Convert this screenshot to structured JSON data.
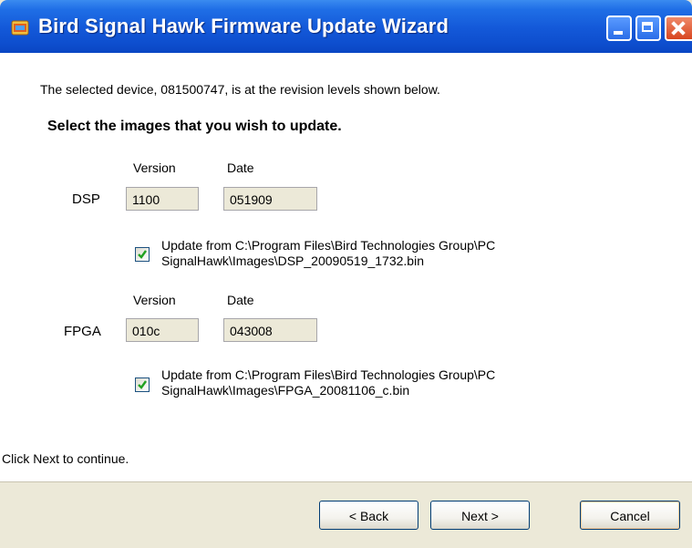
{
  "window": {
    "title": "Bird Signal Hawk Firmware Update Wizard",
    "accent": "#1358d8"
  },
  "intro_text": "The selected device, 081500747, is at the revision levels shown below.",
  "heading": "Select the images that you wish to update.",
  "dsp": {
    "label": "DSP",
    "version_header": "Version",
    "date_header": "Date",
    "version": "1100",
    "date": "051909",
    "update_checked": true,
    "update_line1": "Update from C:\\Program Files\\Bird Technologies Group\\PC",
    "update_line2": "SignalHawk\\Images\\DSP_20090519_1732.bin"
  },
  "fpga": {
    "label": "FPGA",
    "version_header": "Version",
    "date_header": "Date",
    "version": "010c",
    "date": "043008",
    "update_checked": true,
    "update_line1": "Update from C:\\Program Files\\Bird Technologies Group\\PC",
    "update_line2": "SignalHawk\\Images\\FPGA_20081106_c.bin"
  },
  "status_text": "Click Next to continue.",
  "buttons": {
    "back": "< Back",
    "next": "Next >",
    "cancel": "Cancel"
  },
  "icons": [
    "app-icon",
    "minimize-icon",
    "maximize-icon",
    "close-icon",
    "checkmark-icon"
  ]
}
